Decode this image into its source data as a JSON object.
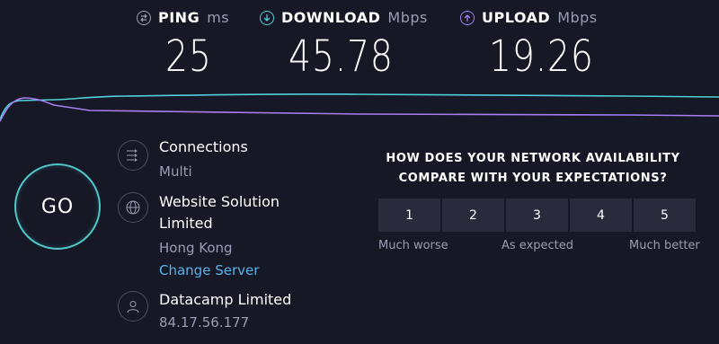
{
  "metrics": {
    "ping": {
      "label": "PING",
      "unit": "ms",
      "value": "25",
      "color": "#9a9cb3"
    },
    "download": {
      "label": "DOWNLOAD",
      "unit": "Mbps",
      "value": "45.78",
      "color": "#4fd1d9"
    },
    "upload": {
      "label": "UPLOAD",
      "unit": "Mbps",
      "value": "19.26",
      "color": "#a67ef2"
    }
  },
  "go_label": "GO",
  "connections": {
    "title": "Connections",
    "value": "Multi"
  },
  "server": {
    "title_line1": "Website Solution",
    "title_line2": "Limited",
    "location": "Hong Kong",
    "change_link": "Change Server"
  },
  "provider": {
    "name": "Datacamp Limited",
    "ip": "84.17.56.177"
  },
  "survey": {
    "question_line1": "HOW DOES YOUR NETWORK AVAILABILITY",
    "question_line2": "COMPARE WITH YOUR EXPECTATIONS?",
    "options": [
      "1",
      "2",
      "3",
      "4",
      "5"
    ],
    "scale_labels": {
      "low": "Much worse",
      "mid": "As expected",
      "high": "Much better"
    }
  },
  "colors": {
    "background": "#161826",
    "download_line": "#4fd1d9",
    "upload_line": "#a67ef2",
    "link": "#5ab3e8"
  }
}
